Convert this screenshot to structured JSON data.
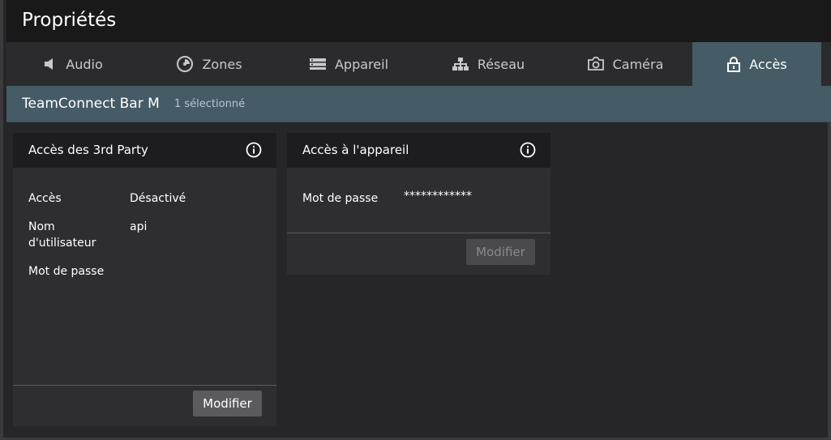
{
  "window": {
    "title": "Propriétés"
  },
  "tabs": [
    {
      "label": "Audio",
      "icon": "speaker-icon"
    },
    {
      "label": "Zones",
      "icon": "zones-icon"
    },
    {
      "label": "Appareil",
      "icon": "device-icon"
    },
    {
      "label": "Réseau",
      "icon": "network-icon"
    },
    {
      "label": "Caméra",
      "icon": "camera-icon"
    },
    {
      "label": "Accès",
      "icon": "lock-icon",
      "active": true
    }
  ],
  "device": {
    "name": "TeamConnect Bar M",
    "selection": "1 sélectionné"
  },
  "third_party": {
    "title": "Accès des 3rd Party",
    "rows": [
      {
        "label": "Accès",
        "value": "Désactivé"
      },
      {
        "label": "Nom d'utilisateur",
        "value": "api"
      },
      {
        "label": "Mot de passe",
        "value": ""
      }
    ],
    "button": "Modifier"
  },
  "device_access": {
    "title": "Accès à l'appareil",
    "rows": [
      {
        "label": "Mot de passe",
        "value": "************"
      }
    ],
    "button": "Modifier",
    "button_enabled": false
  },
  "colors": {
    "accent": "#455b66",
    "header": "#19191a",
    "panel": "#2e2e30"
  }
}
